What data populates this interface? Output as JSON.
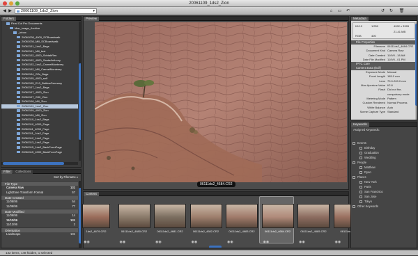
{
  "window": {
    "title": "20061109_1ds2_Zion"
  },
  "toolbar": {
    "path_value": "20061109_1ds2_Zion"
  },
  "panels": {
    "folders_tab": "Folders",
    "favorites_tab": "Favorites",
    "preview_tab": "Preview",
    "content_tab": "Content",
    "metadata_tab": "Metadata",
    "keywords_tab": "Keywords",
    "filter_tab": "Filter",
    "collections_tab": "Collections"
  },
  "folder_tree": [
    {
      "label": "Final Cut Pro Documents",
      "indent": 1
    },
    {
      "label": "Mac_image_Archive",
      "indent": 2
    },
    {
      "label": "_inbox",
      "indent": 3
    },
    {
      "label": "20061030_4000_SCBoardwalk",
      "indent": 4
    },
    {
      "label": "20061030_Mill_SCBoardwalk",
      "indent": 4
    },
    {
      "label": "20061101_1ds2_Bags",
      "indent": 4
    },
    {
      "label": "20061101_Mill_test",
      "indent": 4
    },
    {
      "label": "20061102_4000_SchtabRav",
      "indent": 4
    },
    {
      "label": "20061102_4000_SantaAnthony",
      "indent": 4
    },
    {
      "label": "20061102_1ds2_CarmelMonterey",
      "indent": 4
    },
    {
      "label": "20061102_Mill_CarmelMonterey",
      "indent": 4
    },
    {
      "label": "20061104_G2s_Bags",
      "indent": 4
    },
    {
      "label": "20061105_4000_self",
      "indent": 4
    },
    {
      "label": "20061105_E10_BettinaGermany",
      "indent": 4
    },
    {
      "label": "20061107_1ds2_Bags",
      "indent": 4
    },
    {
      "label": "20061107_4000_Zion",
      "indent": 4
    },
    {
      "label": "20061107_G90_Zion",
      "indent": 4
    },
    {
      "label": "20061108_Mill_Zion",
      "indent": 4
    },
    {
      "label": "20061109_1ds2_Zion",
      "indent": 4,
      "selected": true
    },
    {
      "label": "20061109_4000_Zion",
      "indent": 4
    },
    {
      "label": "20061109_Mill_Zion",
      "indent": 4
    },
    {
      "label": "20061110_1ds2_Bags",
      "indent": 4
    },
    {
      "label": "20061110_4000_Page",
      "indent": 4
    },
    {
      "label": "20061111_4000_Page",
      "indent": 4
    },
    {
      "label": "20061111_1ds2_Page",
      "indent": 4
    },
    {
      "label": "20061112_1ds2_Page",
      "indent": 4
    },
    {
      "label": "20061113_1ds2_Page",
      "indent": 4
    },
    {
      "label": "20061115_1ds2_BackFromPage",
      "indent": 4
    },
    {
      "label": "20061115_4000_BackFromPage",
      "indent": 4
    }
  ],
  "filter": {
    "sort_label": "Sort by Filename",
    "sections": [
      {
        "title": "File Type",
        "rows": [
          {
            "label": "Camera Raw",
            "count": "131",
            "bold": true
          },
          {
            "label": "LightZone Transform Format",
            "count": "57"
          }
        ]
      },
      {
        "title": "Date Created",
        "rows": [
          {
            "label": "11/08/06",
            "count": "54"
          },
          {
            "label": "11/09/06",
            "count": "77"
          }
        ]
      },
      {
        "title": "Date Modified",
        "rows": [
          {
            "label": "11/09/06",
            "count": "14"
          },
          {
            "label": "11/12/06",
            "count": "131",
            "bold": true
          },
          {
            "label": "11/13/06",
            "count": "2"
          }
        ]
      },
      {
        "title": "Orientation",
        "rows": [
          {
            "label": "Landscape",
            "count": "131"
          }
        ]
      }
    ]
  },
  "preview": {
    "filename": "06111ds2_4684.CR2"
  },
  "metadata": {
    "camera_summary": {
      "aperture": "f/10.0",
      "shutter": "1/250",
      "dimensions": "4992 x 3328",
      "size": "21.41 MB",
      "iso": "400",
      "color_space": "RGB"
    },
    "file_properties_title": "File Properties",
    "file_properties": [
      {
        "k": "Filename",
        "v": "06111ds2_4684.CR2"
      },
      {
        "k": "Document Kind",
        "v": "Camera Raw"
      },
      {
        "k": "Date Created",
        "v": "11/9/0...18 AM"
      },
      {
        "k": "Date File Modified",
        "v": "11/9/0...01 PM"
      }
    ],
    "iptc_title": "IPTC Core",
    "camera_data_title": "Camera Data (Exif)",
    "camera_data": [
      {
        "k": "Exposure Mode",
        "v": "Manual"
      },
      {
        "k": "Focal Length",
        "v": "185.0 mm"
      },
      {
        "k": "Lens",
        "v": "70.0-200.0 mm"
      },
      {
        "k": "Max Aperture Value",
        "v": "f/2.8"
      },
      {
        "k": "Flash",
        "v": "Did not fire,"
      },
      {
        "k": "",
        "v": "compulsory mode"
      },
      {
        "k": "Metering Mode",
        "v": "Pattern"
      },
      {
        "k": "Custom Rendered",
        "v": "Normal Process"
      },
      {
        "k": "White Balance",
        "v": "Auto"
      },
      {
        "k": "Scene Capture Type",
        "v": "Standard"
      }
    ]
  },
  "keywords": {
    "header": "Assigned Keywords:",
    "groups": [
      {
        "title": "Events",
        "items": [
          "Birthday",
          "Graduation",
          "Wedding"
        ]
      },
      {
        "title": "People",
        "items": [
          "Matthew",
          "Ryan"
        ]
      },
      {
        "title": "Places",
        "items": [
          "New York",
          "Paris",
          "San Francisco",
          "San Jose",
          "Tokyo"
        ]
      },
      {
        "title": "Other Keywords",
        "items": []
      }
    ]
  },
  "thumbnails": [
    {
      "label": "1ds2_4679.CR2"
    },
    {
      "label": "06111ds2_4680.CR2"
    },
    {
      "label": "06111ds2_4681.CR2"
    },
    {
      "label": "06111ds2_4682.CR2"
    },
    {
      "label": "06111ds2_4683.CR2"
    },
    {
      "label": "06111ds2_4684.CR2",
      "selected": true
    },
    {
      "label": "06111ds2_4685.CR2"
    },
    {
      "label": "06111ds2_468"
    }
  ],
  "status": {
    "text": "132 items, 148 hidden, 1 selected"
  },
  "colors": {
    "selection": "#b7c8dd",
    "scroll_thumb": "#3d73c0",
    "panel_bg": "#4a4a4a",
    "metadata_bg": "#d8d8d8"
  }
}
